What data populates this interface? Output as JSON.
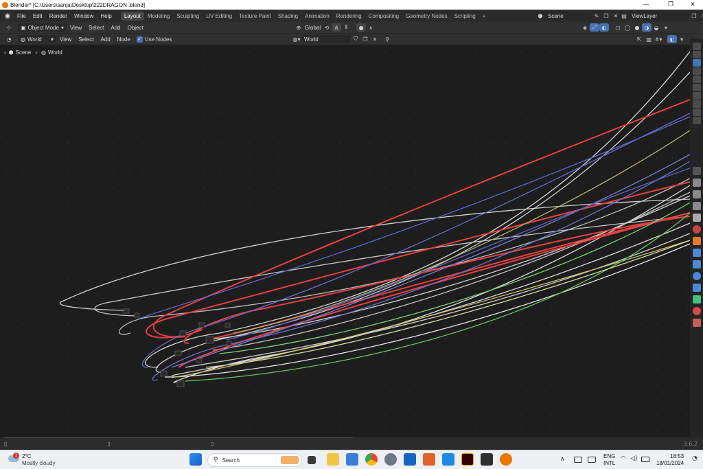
{
  "window": {
    "title": "Blender* [C:\\Users\\sanja\\Desktop\\222DRAGON .blend]"
  },
  "menu": [
    "File",
    "Edit",
    "Render",
    "Window",
    "Help"
  ],
  "workspaces": [
    "Layout",
    "Modeling",
    "Sculpting",
    "UV Editing",
    "Texture Paint",
    "Shading",
    "Animation",
    "Rendering",
    "Compositing",
    "Geometry Nodes",
    "Scripting"
  ],
  "scene": {
    "name": "Scene",
    "view_layer": "ViewLayer"
  },
  "viewport_header": {
    "mode": "Object Mode",
    "items": [
      "View",
      "Select",
      "Add",
      "Object"
    ],
    "orientation": "Global"
  },
  "node_header": {
    "type": "World",
    "items": [
      "View",
      "Select",
      "Add",
      "Node"
    ],
    "use_nodes": "Use Nodes",
    "datablock": "World"
  },
  "breadcrumb": {
    "scene": "Scene",
    "world": "World"
  },
  "status": {
    "version": "3.6.2"
  },
  "taskbar": {
    "temp": "2°C",
    "weather": "Mostly cloudy",
    "badge": "1",
    "search": "Search",
    "lang1": "ENG",
    "lang2": "INTL",
    "time": "18:53",
    "date": "18/01/2024"
  },
  "colors": {
    "accent": "#4772b3",
    "link_red": "#e84141",
    "link_white": "#cfcfcf",
    "link_blue": "#6464c8",
    "link_yellow": "#c8c86a",
    "link_green": "#63c763"
  }
}
